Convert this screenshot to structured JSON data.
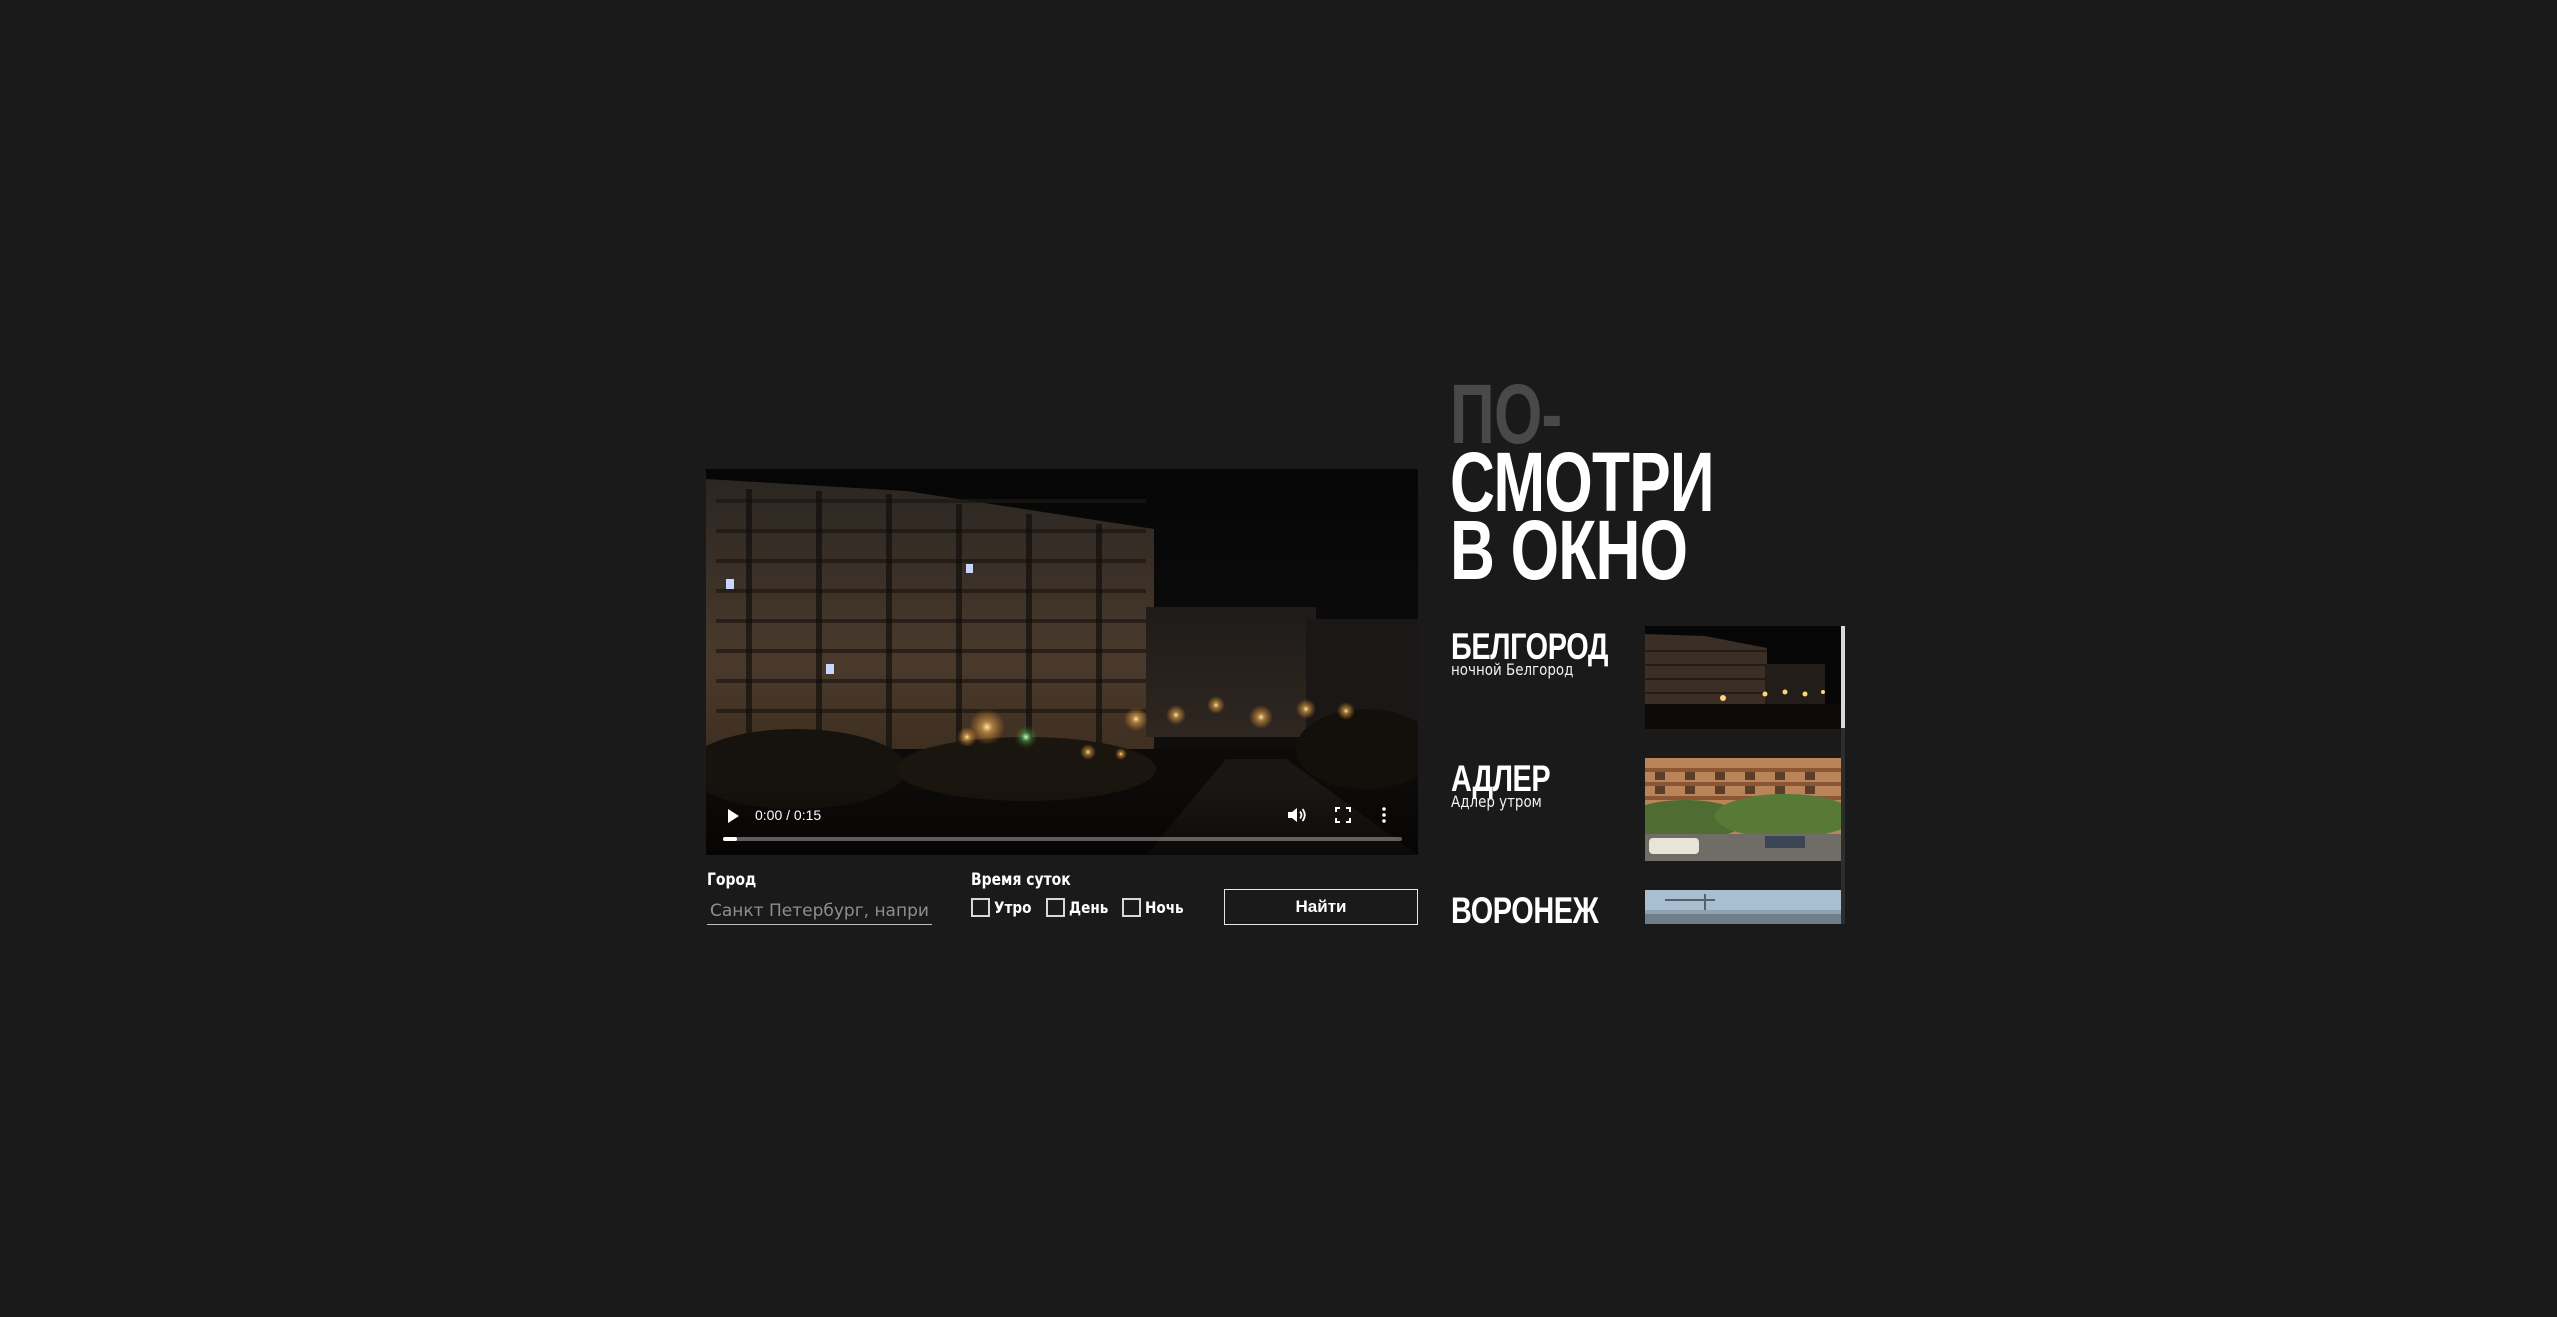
{
  "video": {
    "time_display": "0:00 / 0:15",
    "progress": 0.02,
    "icons": [
      "play-icon",
      "volume-icon",
      "fullscreen-icon",
      "more-options-icon"
    ]
  },
  "search": {
    "city_label": "Город",
    "city_placeholder": "Санкт Петербург, например",
    "city_value": "",
    "time_of_day_label": "Время суток",
    "options": [
      {
        "label": "Утро",
        "checked": false
      },
      {
        "label": "День",
        "checked": false
      },
      {
        "label": "Ночь",
        "checked": false
      }
    ],
    "find_button": "Найти"
  },
  "title": {
    "line1": "ПО-",
    "line2": "СМОТРИ",
    "line3": "В ОКНО"
  },
  "cities": [
    {
      "name": "БЕЛГОРОД",
      "description": "ночной Белгород"
    },
    {
      "name": "АДЛЕР",
      "description": "Адлер утром"
    },
    {
      "name": "ВОРОНЕЖ",
      "description": ""
    }
  ],
  "colors": {
    "background": "#1b1a1b",
    "text": "#ffffff",
    "title_faded": "#4a494a",
    "scrollbar_thumb": "#d9d9d9"
  }
}
